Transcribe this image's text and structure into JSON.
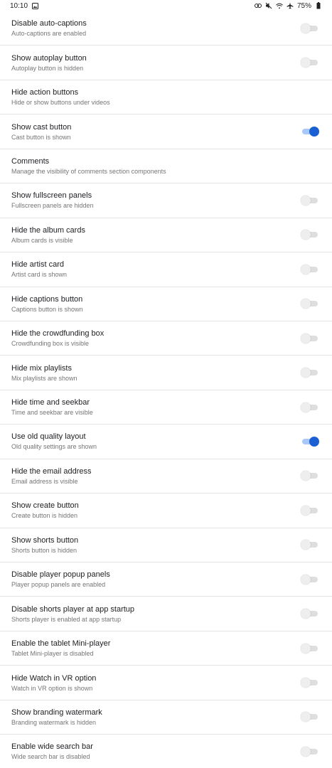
{
  "status_bar": {
    "time": "10:10",
    "battery": "75%",
    "icons": [
      "image-notification-icon",
      "link-icon",
      "mute-icon",
      "wifi-icon",
      "airplane-icon",
      "battery-icon"
    ]
  },
  "colors": {
    "accent": "#1a5fd3",
    "switch_on_track": "#a8c7fa",
    "switch_off_track": "#dedede",
    "divider": "#e4e4e4"
  },
  "settings": [
    {
      "title": "Disable auto-captions",
      "summary": "Auto-captions are enabled",
      "toggle": "off"
    },
    {
      "title": "Show autoplay button",
      "summary": "Autoplay button is hidden",
      "toggle": "off"
    },
    {
      "title": "Hide action buttons",
      "summary": "Hide or show buttons under videos",
      "toggle": "none"
    },
    {
      "title": "Show cast button",
      "summary": "Cast button is shown",
      "toggle": "on"
    },
    {
      "title": "Comments",
      "summary": "Manage the visibility of comments section components",
      "toggle": "none"
    },
    {
      "title": "Show fullscreen panels",
      "summary": "Fullscreen panels are hidden",
      "toggle": "off"
    },
    {
      "title": "Hide the album cards",
      "summary": "Album cards is visible",
      "toggle": "off"
    },
    {
      "title": "Hide artist card",
      "summary": "Artist card is shown",
      "toggle": "off"
    },
    {
      "title": "Hide captions button",
      "summary": "Captions button is shown",
      "toggle": "off"
    },
    {
      "title": "Hide the crowdfunding box",
      "summary": "Crowdfunding box is visible",
      "toggle": "off"
    },
    {
      "title": "Hide mix playlists",
      "summary": "Mix playlists are shown",
      "toggle": "off"
    },
    {
      "title": "Hide time and seekbar",
      "summary": "Time and seekbar are visible",
      "toggle": "off"
    },
    {
      "title": "Use old quality layout",
      "summary": "Old quality settings are shown",
      "toggle": "on"
    },
    {
      "title": "Hide the email address",
      "summary": "Email address is visible",
      "toggle": "off"
    },
    {
      "title": "Show create button",
      "summary": "Create button is hidden",
      "toggle": "off"
    },
    {
      "title": "Show shorts button",
      "summary": "Shorts button is hidden",
      "toggle": "off"
    },
    {
      "title": "Disable player popup panels",
      "summary": "Player popup panels are enabled",
      "toggle": "off"
    },
    {
      "title": "Disable shorts player at app startup",
      "summary": "Shorts player is enabled at app startup",
      "toggle": "off"
    },
    {
      "title": "Enable the tablet Mini-player",
      "summary": "Tablet Mini-player is disabled",
      "toggle": "off"
    },
    {
      "title": "Hide Watch in VR option",
      "summary": "Watch in VR option is shown",
      "toggle": "off"
    },
    {
      "title": "Show branding watermark",
      "summary": "Branding watermark is hidden",
      "toggle": "off"
    },
    {
      "title": "Enable wide search bar",
      "summary": "Wide search bar is disabled",
      "toggle": "off"
    }
  ]
}
